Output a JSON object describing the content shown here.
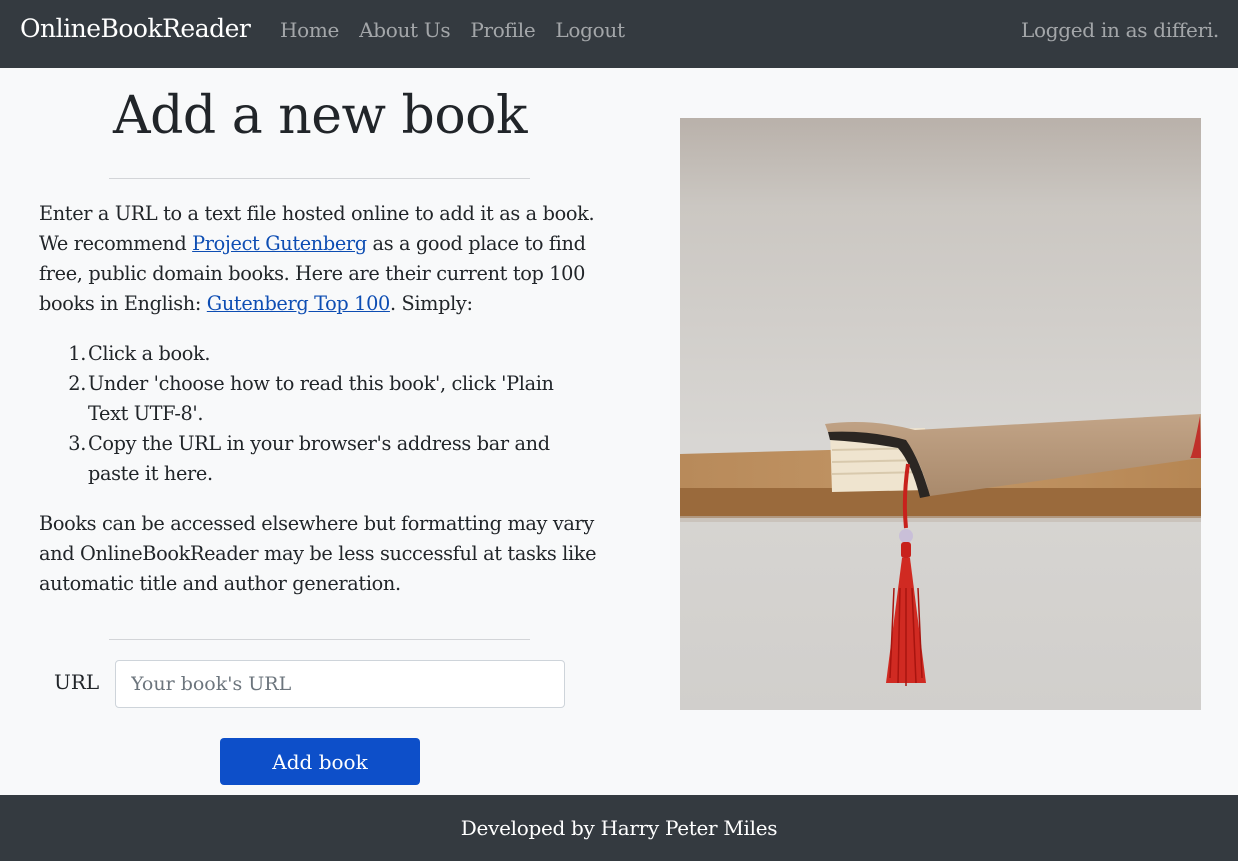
{
  "navbar": {
    "brand": "OnlineBookReader",
    "links": [
      "Home",
      "About Us",
      "Profile",
      "Logout"
    ],
    "user_status": "Logged in as differi."
  },
  "main": {
    "title": "Add a new book",
    "intro": {
      "part1": "Enter a URL to a text file hosted online to add it as a book. We recommend ",
      "link1": "Project Gutenberg",
      "part2": " as a good place to find free, public domain books. Here are their current top 100 books in English: ",
      "link2": "Gutenberg Top 100",
      "part3": ". Simply:"
    },
    "steps": [
      "Click a book.",
      "Under 'choose how to read this book', click 'Plain Text UTF-8'.",
      "Copy the URL in your browser's address bar and paste it here."
    ],
    "outro": "Books can be accessed elsewhere but formatting may vary and OnlineBookReader may be less successful at tasks like automatic title and author generation.",
    "form": {
      "url_label": "URL",
      "url_value": "",
      "url_placeholder": "Your book's URL",
      "submit_label": "Add book"
    }
  },
  "colors": {
    "navbar_bg": "#343a40",
    "page_bg": "#f8f9fa",
    "link": "#0d4db3",
    "button_primary": "#0d4fc9"
  },
  "footer": {
    "text": "Developed by Harry Peter Miles"
  }
}
